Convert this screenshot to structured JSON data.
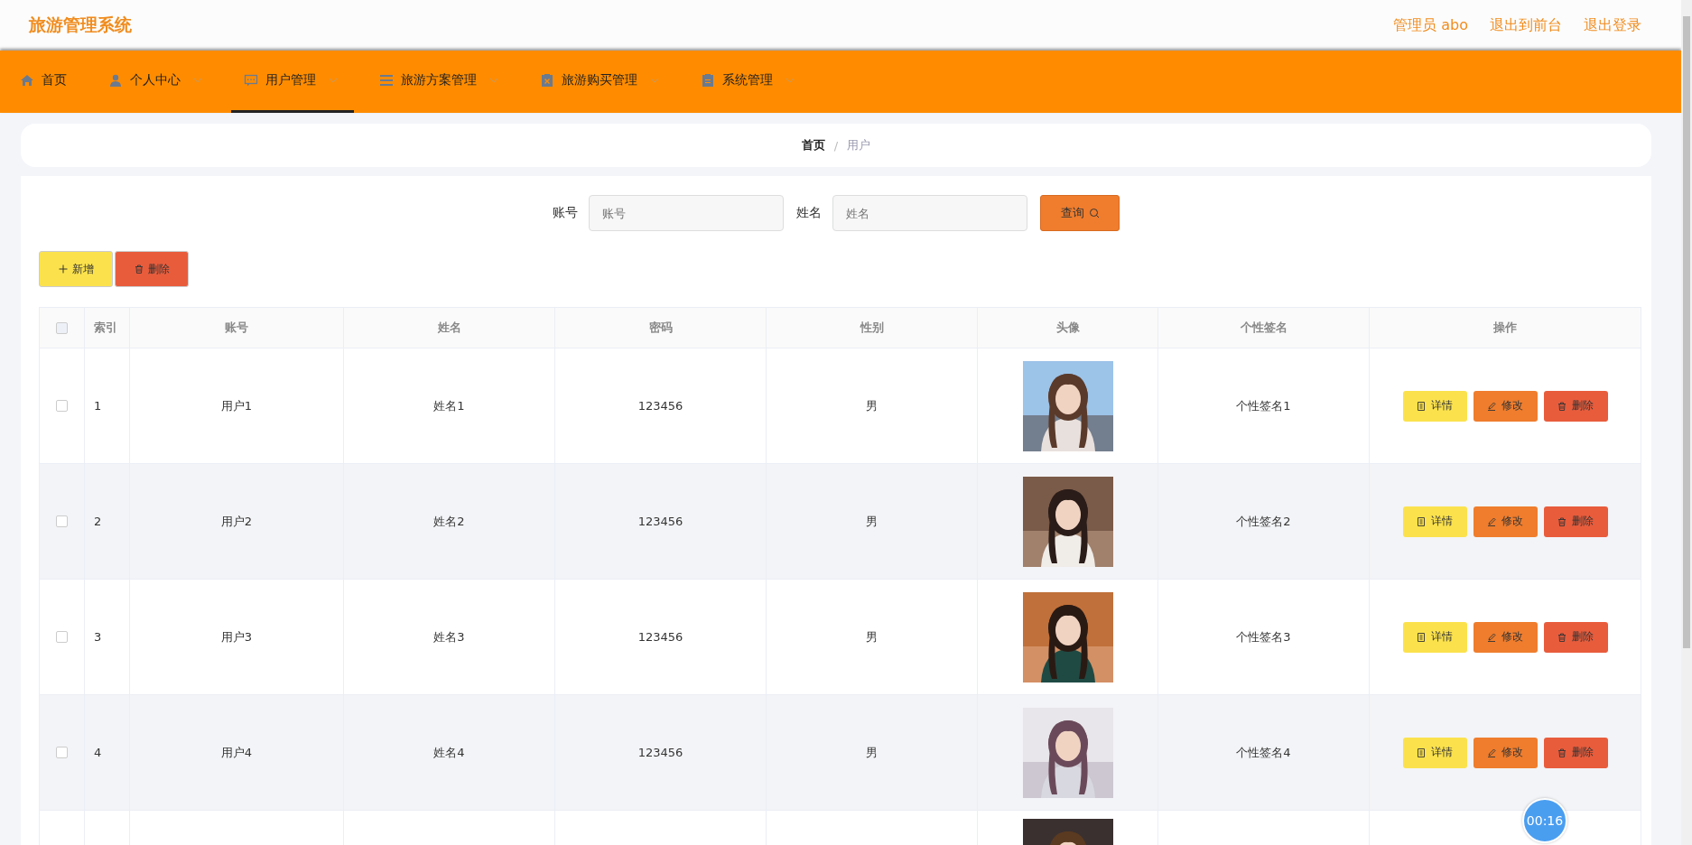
{
  "header": {
    "title": "旅游管理系统",
    "links": [
      "管理员 abo",
      "退出到前台",
      "退出登录"
    ]
  },
  "nav": [
    {
      "label": "首页",
      "kind": "home",
      "selected": false,
      "has_menu": false
    },
    {
      "label": "个人中心",
      "kind": "person",
      "selected": false,
      "has_menu": true
    },
    {
      "label": "用户管理",
      "kind": "users",
      "selected": true,
      "has_menu": true
    },
    {
      "label": "旅游方案管理",
      "kind": "plans",
      "selected": false,
      "has_menu": true
    },
    {
      "label": "旅游购买管理",
      "kind": "purchases",
      "selected": false,
      "has_menu": true
    },
    {
      "label": "系统管理",
      "kind": "system",
      "selected": false,
      "has_menu": true
    }
  ],
  "breadcrumb": {
    "items": [
      "首页",
      "用户"
    ],
    "separator": "/"
  },
  "search": {
    "fields": [
      {
        "label": "账号",
        "placeholder": "账号"
      },
      {
        "label": "姓名",
        "placeholder": "姓名"
      }
    ],
    "button": "查询"
  },
  "toolbar": [
    {
      "kind": "add",
      "label": "新增"
    },
    {
      "kind": "delete",
      "label": "删除"
    }
  ],
  "table": {
    "select_all_checked": false,
    "columns": [
      "索引",
      "账号",
      "姓名",
      "密码",
      "性别",
      "头像",
      "个性签名",
      "操作"
    ],
    "rows": [
      {
        "checked": false,
        "index": "1",
        "account": "用户1",
        "name": "姓名1",
        "password": "123456",
        "gender": "男",
        "avatar": {
          "kind": "picture"
        },
        "signature": "个性签名1",
        "actions": [
          {
            "kind": "detail",
            "label": "详情"
          },
          {
            "kind": "edit",
            "label": "修改"
          },
          {
            "kind": "delete",
            "label": "删除"
          }
        ]
      },
      {
        "checked": false,
        "index": "2",
        "account": "用户2",
        "name": "姓名2",
        "password": "123456",
        "gender": "男",
        "avatar": {
          "kind": "picture"
        },
        "signature": "个性签名2",
        "actions": [
          {
            "kind": "detail",
            "label": "详情"
          },
          {
            "kind": "edit",
            "label": "修改"
          },
          {
            "kind": "delete",
            "label": "删除"
          }
        ]
      },
      {
        "checked": false,
        "index": "3",
        "account": "用户3",
        "name": "姓名3",
        "password": "123456",
        "gender": "男",
        "avatar": {
          "kind": "picture"
        },
        "signature": "个性签名3",
        "actions": [
          {
            "kind": "detail",
            "label": "详情"
          },
          {
            "kind": "edit",
            "label": "修改"
          },
          {
            "kind": "delete",
            "label": "删除"
          }
        ]
      },
      {
        "checked": false,
        "index": "4",
        "account": "用户4",
        "name": "姓名4",
        "password": "123456",
        "gender": "男",
        "avatar": {
          "kind": "picture"
        },
        "signature": "个性签名4",
        "actions": [
          {
            "kind": "detail",
            "label": "详情"
          },
          {
            "kind": "edit",
            "label": "修改"
          },
          {
            "kind": "delete",
            "label": "删除"
          }
        ]
      },
      {
        "avatar": {
          "kind": "picture"
        }
      }
    ]
  },
  "timer": "00:16"
}
